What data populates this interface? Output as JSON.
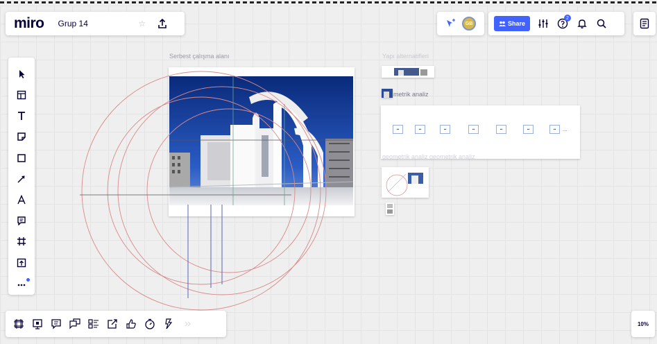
{
  "app": {
    "logo": "miro",
    "board_name": "Grup 14"
  },
  "topbar": {
    "share_label": "Share",
    "avatar_initials": "GB",
    "notification_count": "2"
  },
  "canvas": {
    "workspace_label": "Serbest çalışma alanı",
    "alternatives_label": "Yapı alternatifleri",
    "geometric_label": "metrik analiz",
    "geometric_repeat_label": "geometrik analiz geometrik analiz",
    "cards_more": "..."
  },
  "zoom": {
    "level": "10%"
  },
  "colors": {
    "accent": "#4262ff",
    "guide_red": "#d98a8a",
    "guide_blue": "#5a63b8"
  }
}
